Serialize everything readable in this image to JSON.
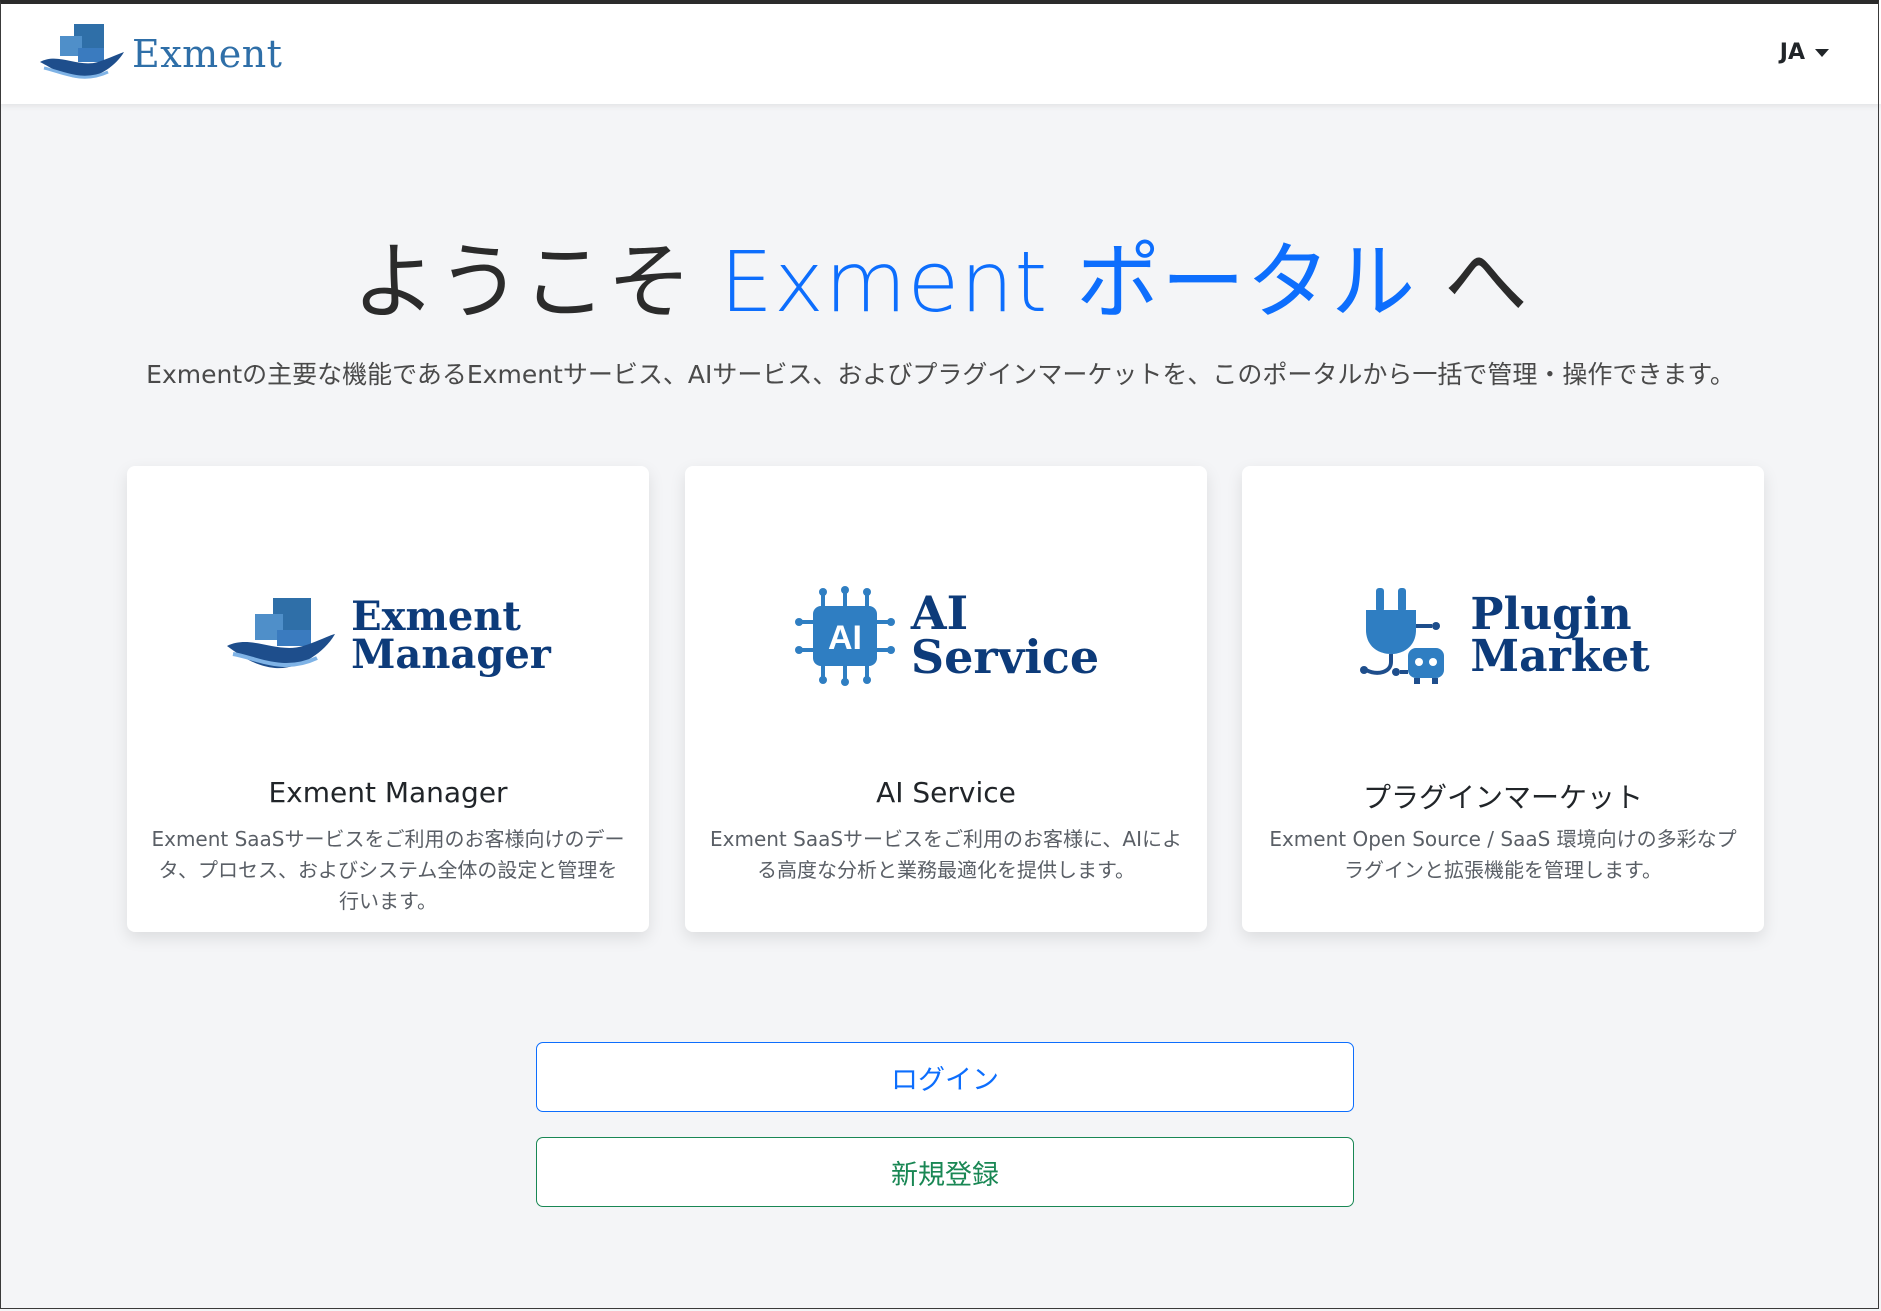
{
  "header": {
    "brand_name": "Exment",
    "language": "JA"
  },
  "hero": {
    "title_prefix": "ようこそ ",
    "title_accent": "Exment ポータル",
    "title_suffix": " へ",
    "subtitle": "Exmentの主要な機能であるExmentサービス、AIサービス、およびプラグインマーケットを、このポータルから一括で管理・操作できます。"
  },
  "cards": [
    {
      "logo_line1": "Exment",
      "logo_line2": "Manager",
      "title": "Exment Manager",
      "description": "Exment SaaSサービスをご利用のお客様向けのデータ、プロセス、およびシステム全体の設定と管理を行います。"
    },
    {
      "logo_badge": "AI",
      "logo_line1": "AI",
      "logo_line2": "Service",
      "title": "AI Service",
      "description": "Exment SaaSサービスをご利用のお客様に、AIによる高度な分析と業務最適化を提供します。"
    },
    {
      "logo_line1": "Plugin",
      "logo_line2": "Market",
      "title": "プラグインマーケット",
      "description": "Exment Open Source / SaaS 環境向けの多彩なプラグインと拡張機能を管理します。"
    }
  ],
  "buttons": {
    "login": "ログイン",
    "register": "新規登録"
  },
  "colors": {
    "accent": "#0d6efd",
    "success": "#198754",
    "logo_blue": "#2f6fa8",
    "logo_navy": "#0d3b7a"
  }
}
